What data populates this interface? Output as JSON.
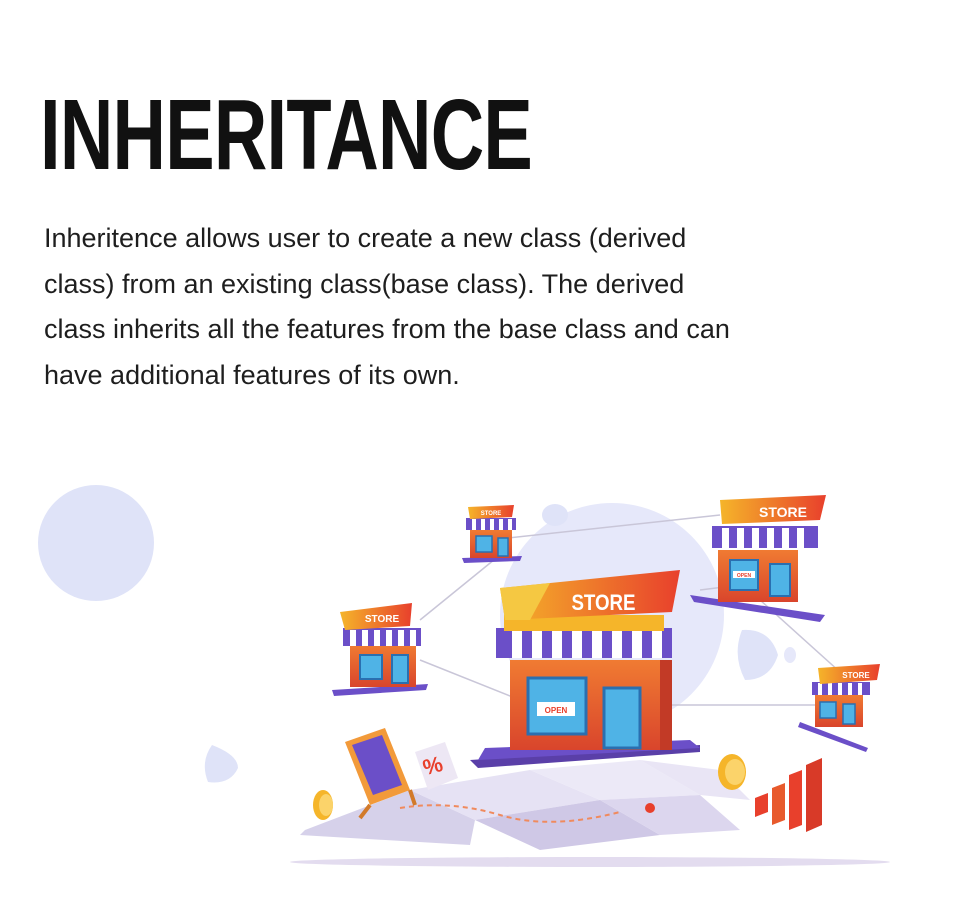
{
  "header": {
    "title": "INHERITANCE"
  },
  "body": {
    "lines": [
      "Inheritence allows user to create a new class (derived",
      "class) from an existing class(base class). The derived",
      "class inherits all the features from the base class and can",
      "have additional features of its own."
    ]
  },
  "illustration": {
    "main_store_sign": "STORE",
    "main_door_sign": "OPEN",
    "store_tl_sign": "STORE",
    "store_tr_sign": "STORE",
    "store_tr_door": "OPEN",
    "store_left_sign": "STORE",
    "store_right_sign": "STORE",
    "discount_symbol": "%",
    "colors": {
      "accent_red": "#e84a2f",
      "accent_orange": "#f59a2a",
      "awning_purple": "#6b4fc8",
      "window_blue": "#4fb3e6",
      "pale_blue": "#dfe3f8",
      "ground_shadow": "#ddd5ee"
    }
  }
}
